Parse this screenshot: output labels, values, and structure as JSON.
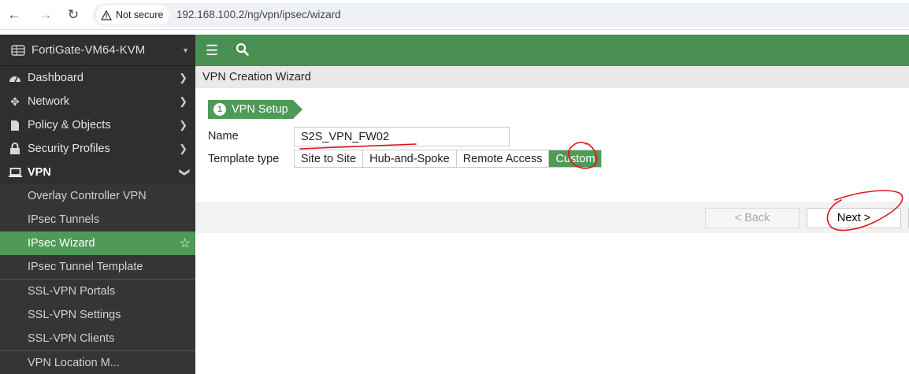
{
  "browser": {
    "security_label": "Not secure",
    "url": "192.168.100.2/ng/vpn/ipsec/wizard"
  },
  "sidebar": {
    "device_name": "FortiGate-VM64-KVM",
    "items": [
      {
        "label": "Dashboard",
        "icon": "dashboard-icon"
      },
      {
        "label": "Network",
        "icon": "network-icon"
      },
      {
        "label": "Policy & Objects",
        "icon": "policy-icon"
      },
      {
        "label": "Security Profiles",
        "icon": "lock-icon"
      },
      {
        "label": "VPN",
        "icon": "laptop-icon"
      }
    ],
    "vpn_subitems": [
      {
        "label": "Overlay Controller VPN"
      },
      {
        "label": "IPsec Tunnels"
      },
      {
        "label": "IPsec Wizard"
      },
      {
        "label": "IPsec Tunnel Template"
      },
      {
        "label": "SSL-VPN Portals"
      },
      {
        "label": "SSL-VPN Settings"
      },
      {
        "label": "SSL-VPN Clients"
      },
      {
        "label": "VPN Location M..."
      }
    ]
  },
  "page": {
    "title": "VPN Creation Wizard",
    "step_number": "1",
    "step_label": "VPN Setup",
    "name_label": "Name",
    "name_value": "S2S_VPN_FW02",
    "template_label": "Template type",
    "template_options": [
      {
        "label": "Site to Site"
      },
      {
        "label": "Hub-and-Spoke"
      },
      {
        "label": "Remote Access"
      },
      {
        "label": "Custom"
      }
    ],
    "selected_template": "Custom",
    "back_label": "< Back",
    "next_label": "Next >"
  },
  "colors": {
    "accent_green": "#4a8f52",
    "sidebar_bg": "#2f2f2f",
    "annotation_red": "#e0151d"
  }
}
